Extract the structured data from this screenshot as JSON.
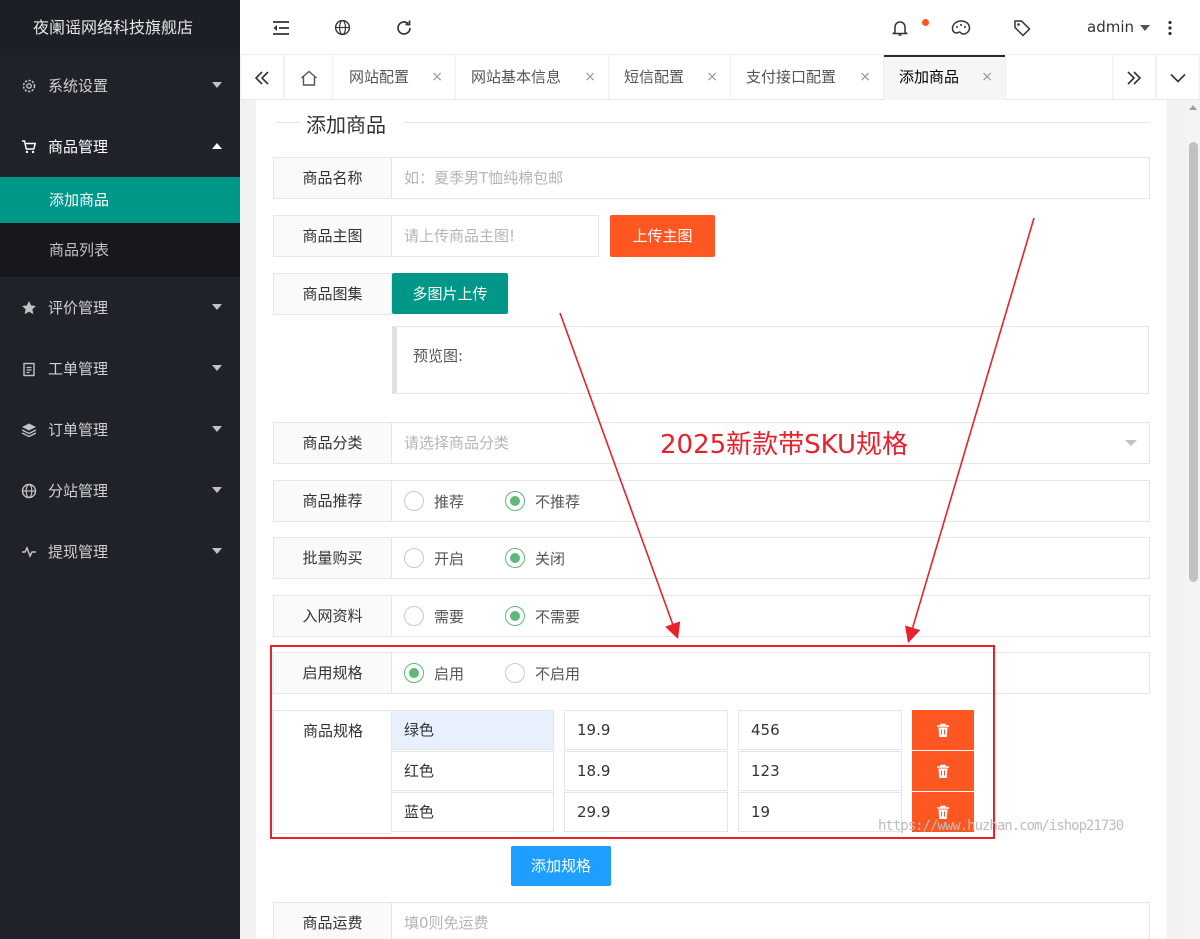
{
  "sidebar": {
    "logo": "夜阑谣网络科技旗舰店",
    "items": [
      {
        "label": "系统设置",
        "icon": "gear-icon"
      },
      {
        "label": "商品管理",
        "icon": "cart-icon"
      },
      {
        "label": "评价管理",
        "icon": "star-icon"
      },
      {
        "label": "工单管理",
        "icon": "clipboard-icon"
      },
      {
        "label": "订单管理",
        "icon": "layers-icon"
      },
      {
        "label": "分站管理",
        "icon": "globe-icon"
      },
      {
        "label": "提现管理",
        "icon": "pulse-icon"
      }
    ],
    "sub_items": [
      "添加商品",
      "商品列表"
    ]
  },
  "header": {
    "user": "admin"
  },
  "tabs": [
    {
      "label": "网站配置"
    },
    {
      "label": "网站基本信息"
    },
    {
      "label": "短信配置"
    },
    {
      "label": "支付接口配置"
    },
    {
      "label": "添加商品"
    }
  ],
  "tab_close": "×",
  "form": {
    "title": "添加商品",
    "name_label": "商品名称",
    "name_placeholder": "如：夏季男T恤纯棉包邮",
    "image_label": "商品主图",
    "image_placeholder": "请上传商品主图!",
    "upload_main": "上传主图",
    "gallery_label": "商品图集",
    "upload_multi": "多图片上传",
    "preview_label": "预览图:",
    "category_label": "商品分类",
    "category_placeholder": "请选择商品分类",
    "recommend_label": "商品推荐",
    "recommend_yes": "推荐",
    "recommend_no": "不推荐",
    "bulk_label": "批量购买",
    "bulk_on": "开启",
    "bulk_off": "关闭",
    "network_label": "入网资料",
    "network_need": "需要",
    "network_noneed": "不需要",
    "spec_enable_label": "启用规格",
    "spec_enable": "启用",
    "spec_disable": "不启用",
    "spec_label": "商品规格",
    "specs": [
      {
        "name": "绿色",
        "price": "19.9",
        "stock": "456"
      },
      {
        "name": "红色",
        "price": "18.9",
        "stock": "123"
      },
      {
        "name": "蓝色",
        "price": "29.9",
        "stock": "19"
      }
    ],
    "add_spec": "添加规格",
    "shipping_label": "商品运费",
    "shipping_placeholder": "填0则免运费"
  },
  "annotation": "2025新款带SKU规格",
  "watermark": "https://www.huzhan.com/ishop21730",
  "colors": {
    "sidebar": "#20222a",
    "accent": "#009688",
    "orange": "#ff5722",
    "blue": "#1e9fff",
    "annotation": "#e8212d"
  }
}
